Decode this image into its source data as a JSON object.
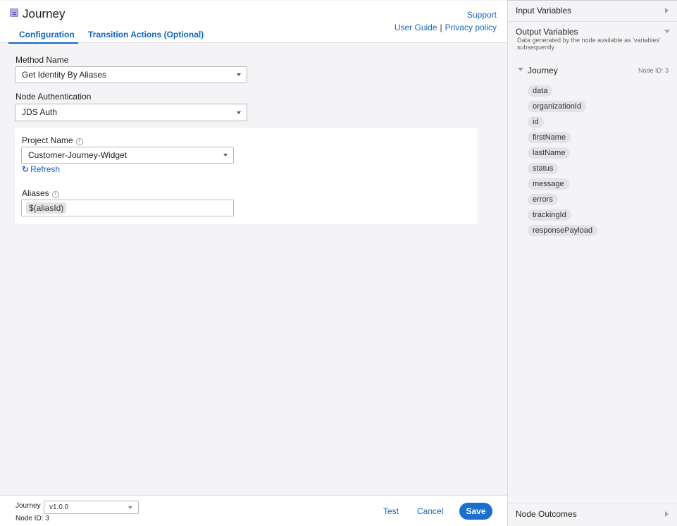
{
  "header": {
    "title": "Journey",
    "tabs": [
      {
        "label": "Configuration",
        "active": true
      },
      {
        "label": "Transition Actions (Optional)",
        "active": false
      }
    ],
    "links": {
      "support": "Support",
      "user_guide": "User Guide",
      "separator": "|",
      "privacy": "Privacy policy"
    }
  },
  "form": {
    "method": {
      "label": "Method Name",
      "value": "Get Identity By Aliases"
    },
    "auth": {
      "label": "Node Authentication",
      "value": "JDS Auth"
    },
    "project": {
      "label": "Project Name",
      "value": "Customer-Journey-Widget"
    },
    "refresh_label": "Refresh",
    "aliases": {
      "label": "Aliases",
      "chip": "$(aliasId)"
    }
  },
  "footer": {
    "label": "Journey",
    "version": "v1.0.0",
    "node_id": "Node ID: 3",
    "test": "Test",
    "cancel": "Cancel",
    "save": "Save"
  },
  "side": {
    "input_variables": "Input Variables",
    "output_variables": "Output Variables",
    "output_description": "Data generated by the node available as 'variables' subsequently",
    "journey_title": "Journey",
    "journey_node_id": "Node ID: 3",
    "variables": [
      "data",
      "organizationId",
      "id",
      "firstName",
      "lastName",
      "status",
      "message",
      "errors",
      "trackingId",
      "responsePayload"
    ],
    "node_outcomes": "Node Outcomes"
  },
  "colors": {
    "accent": "#1166c5",
    "save_button": "#1a6fd1",
    "page_bg": "#f4f4f6"
  },
  "icons": [
    "journey-app-icon",
    "dropdown-caret-icon",
    "info-icon",
    "refresh-icon",
    "expand-triangle-icon",
    "collapse-triangle-icon"
  ]
}
